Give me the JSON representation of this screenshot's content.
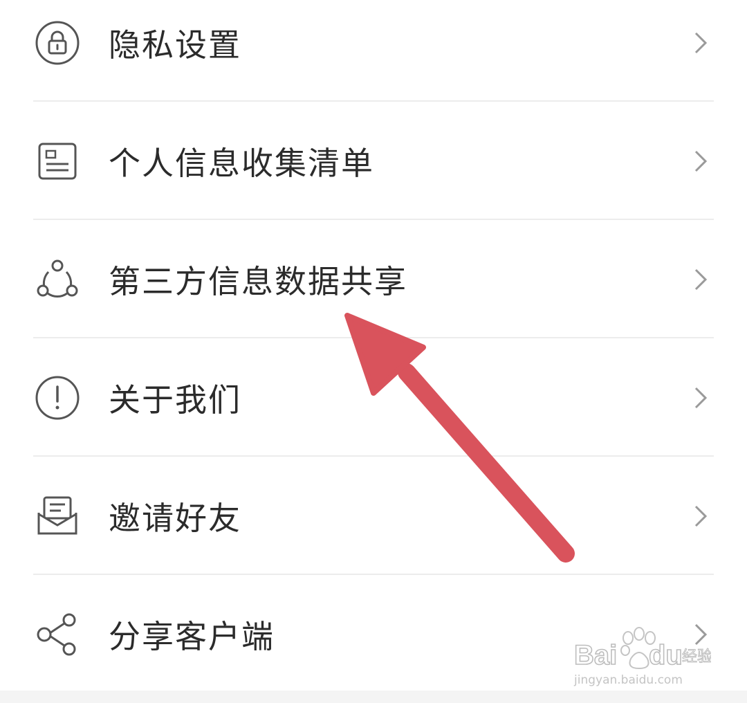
{
  "menu": {
    "items": [
      {
        "label": "隐私设置",
        "icon": "lock-icon"
      },
      {
        "label": "个人信息收集清单",
        "icon": "document-list-icon"
      },
      {
        "label": "第三方信息数据共享",
        "icon": "share-network-icon"
      },
      {
        "label": "关于我们",
        "icon": "info-exclamation-icon"
      },
      {
        "label": "邀请好友",
        "icon": "envelope-icon"
      },
      {
        "label": "分享客户端",
        "icon": "share-icon"
      }
    ],
    "chevron_icon": "chevron-right-icon"
  },
  "annotation": {
    "icon": "red-arrow-icon",
    "color": "#d9535c"
  },
  "watermark": {
    "brand": "Baidu经验",
    "url": "jingyan.baidu.com"
  },
  "colors": {
    "text": "#2b2b2b",
    "icon_stroke": "#555555",
    "divider": "#ececec",
    "chevron": "#9a9a9a"
  }
}
